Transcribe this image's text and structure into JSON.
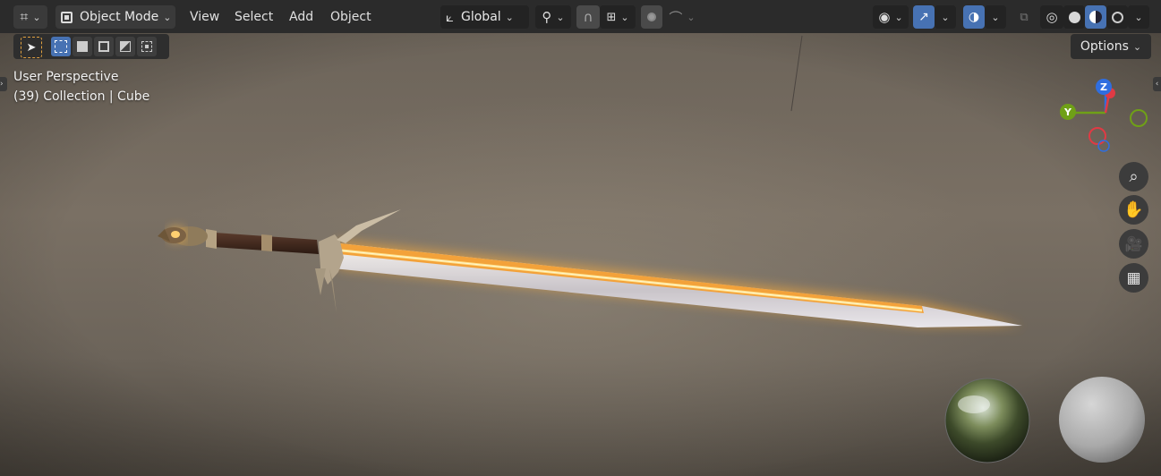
{
  "header": {
    "editor_type_icon": "axis-grid-icon",
    "mode": {
      "label": "Object Mode",
      "icon": "object-mode-icon"
    },
    "menus": [
      "View",
      "Select",
      "Add",
      "Object"
    ],
    "transform_orientation": {
      "label": "Global",
      "icon": "orientation-axes-icon"
    },
    "pivot_icon": "pivot-link-icon",
    "snap_icon": "magnet-snap-icon",
    "snap_target_icon": "snap-increment-icon",
    "proportional_icon": "proportional-edit-icon",
    "falloff_icon": "falloff-curve-icon",
    "visibility_icon": "eye-visibility-icon",
    "gizmo_icon": "gizmo-toggle-icon",
    "overlay_icon": "overlay-toggle-icon",
    "xray_icon": "xray-toggle-icon",
    "shading_modes": [
      "wireframe-shading-icon",
      "solid-shading-icon",
      "material-preview-shading-icon",
      "rendered-shading-icon"
    ],
    "active_shading": "material-preview-shading-icon"
  },
  "toolbar": {
    "select_tool_icon": "select-cursor-icon",
    "select_modes": [
      "select-box-new-icon",
      "select-box-extend-icon",
      "select-box-subtract-icon",
      "select-box-invert-icon",
      "select-box-intersect-icon"
    ]
  },
  "viewport_info": {
    "view_name": "User Perspective",
    "collection_line": "(39) Collection | Cube"
  },
  "options": {
    "label": "Options"
  },
  "navigation_gizmo": {
    "axes": [
      {
        "label": "Z",
        "color": "#2f6ee0"
      },
      {
        "label": "Y",
        "color": "#6fa017"
      },
      {
        "label": "X",
        "color": "#e03a44"
      }
    ]
  },
  "nav_buttons": [
    "zoom-icon",
    "pan-hand-icon",
    "camera-view-icon",
    "orthographic-grid-icon"
  ],
  "colors": {
    "header_bg": "#2b2b2b",
    "button_bg": "#3a3a3a",
    "active_blue": "#4772b3",
    "blade_glow": "#ffb43a",
    "blade_edge": "#ffe08a"
  }
}
